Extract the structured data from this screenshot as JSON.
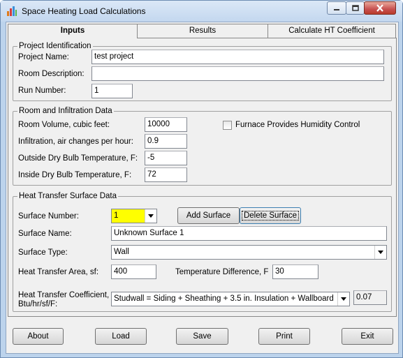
{
  "window": {
    "title": "Space Heating Load Calculations",
    "icon": "bar-chart-icon"
  },
  "tabs": [
    {
      "label": "Inputs",
      "active": true
    },
    {
      "label": "Results",
      "active": false
    },
    {
      "label": "Calculate HT Coefficient",
      "active": false
    }
  ],
  "project": {
    "group_label": "Project Identification",
    "name_label": "Project Name:",
    "name_value": "test project",
    "desc_label": "Room Description:",
    "desc_value": "",
    "run_label": "Run Number:",
    "run_value": "1"
  },
  "room": {
    "group_label": "Room and Infiltration Data",
    "volume_label": "Room Volume, cubic feet:",
    "volume_value": "10000",
    "infil_label": "Infiltration, air changes per hour:",
    "infil_value": "0.9",
    "outside_label": "Outside Dry Bulb Temperature, F:",
    "outside_value": "-5",
    "inside_label": "Inside Dry Bulb Temperature, F:",
    "inside_value": "72",
    "furnace_label": "Furnace Provides Humidity Control",
    "furnace_checked": false
  },
  "surface": {
    "group_label": "Heat Transfer Surface Data",
    "number_label": "Surface Number:",
    "number_value": "1",
    "number_highlight": "#ffff00",
    "add_label": "Add Surface",
    "delete_label": "Delete Surface",
    "name_label": "Surface Name:",
    "name_value": "Unknown Surface 1",
    "type_label": "Surface Type:",
    "type_value": "Wall",
    "area_label": "Heat Transfer Area, sf:",
    "area_value": "400",
    "tempdiff_label": "Temperature Difference, F",
    "tempdiff_value": "30",
    "coef_label_1": "Heat Transfer Coefficient,",
    "coef_label_2": "Btu/hr/sf/F:",
    "coef_select": "Studwall = Siding + Sheathing + 3.5 in. Insulation + Wallboard",
    "coef_value": "0.07"
  },
  "buttons": {
    "about": "About",
    "load": "Load",
    "save": "Save",
    "print": "Print",
    "exit": "Exit"
  }
}
